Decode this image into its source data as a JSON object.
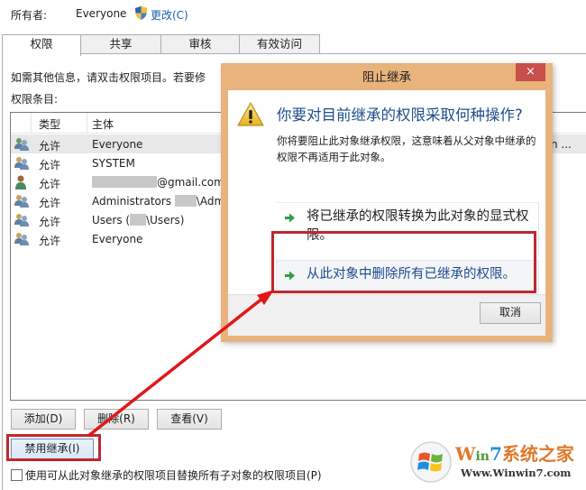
{
  "owner": {
    "label": "所有者:",
    "value": "Everyone",
    "change_link": "更改(C)"
  },
  "tabs": [
    {
      "label": "权限",
      "active": true
    },
    {
      "label": "共享",
      "active": false
    },
    {
      "label": "审核",
      "active": false
    },
    {
      "label": "有效访问",
      "active": false
    }
  ],
  "info_text": "如需其他信息，请双击权限项目。若要修",
  "entries_label": "权限条目:",
  "list": {
    "columns": [
      "类型",
      "主体"
    ],
    "rows": [
      {
        "type": "允许",
        "principal": "Everyone",
        "extra": "n ...",
        "icon": "group-icon",
        "selected": true
      },
      {
        "type": "允许",
        "principal": "SYSTEM",
        "icon": "group-icon"
      },
      {
        "type": "允许",
        "principal": "@gmail.com",
        "icon": "user-icon",
        "redacted_prefix": true
      },
      {
        "type": "允许",
        "principal_a": "Administrators ",
        "principal_b": "\\Admi",
        "icon": "group-icon"
      },
      {
        "type": "允许",
        "principal_a": "Users (",
        "principal_b": "\\Users)",
        "icon": "group-icon"
      },
      {
        "type": "允许",
        "principal": "Everyone",
        "icon": "group-icon"
      }
    ]
  },
  "buttons": {
    "add": "添加(D)",
    "remove": "删除(R)",
    "view": "查看(V)",
    "disable_inheritance": "禁用继承(I)"
  },
  "checkbox": {
    "label": "使用可从此对象继承的权限项目替换所有子对象的权限项目(P)",
    "checked": false
  },
  "dialog": {
    "title": "阻止继承",
    "close": "×",
    "heading": "你要对目前继承的权限采取何种操作?",
    "description": "你将要阻止此对象继承权限，这意味着从父对象中继承的权限不再适用于此对象。",
    "option_convert": "将已继承的权限转换为此对象的显式权限。",
    "option_remove": "从此对象中删除所有已继承的权限。",
    "cancel": "取消"
  },
  "watermark": {
    "brand_w": "W",
    "brand_in": "in",
    "brand_7": "7",
    "brand_cn": "系统之家",
    "url": "Www.Winwin7.com"
  },
  "colors": {
    "highlight_red": "#c0282e",
    "dialog_frame": "#e8b37d",
    "link_blue": "#1a5fb4",
    "heading_blue": "#1e4e8c"
  }
}
